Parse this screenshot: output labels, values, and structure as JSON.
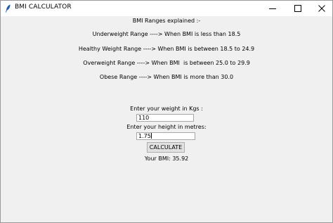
{
  "window": {
    "title": "BMI CALCULATOR"
  },
  "ranges": {
    "heading": "BMI Ranges explained :-",
    "underweight": "Underweight Range ----> When BMI is less than 18.5",
    "healthy": "Healthy Weight Range ----> When BMI is between 18.5 to 24.9",
    "overweight": "Overweight Range ----> When BMI  is between 25.0 to 29.9",
    "obese": "Obese Range ----> When BMI is more than 30.0"
  },
  "form": {
    "weight_label": "Enter your weight in Kgs :",
    "weight_value": "110",
    "height_label": "Enter your height in metres:",
    "height_value": "1.75",
    "calculate_label": "CALCULATE",
    "result_text": "Your BMI: 35.92"
  }
}
